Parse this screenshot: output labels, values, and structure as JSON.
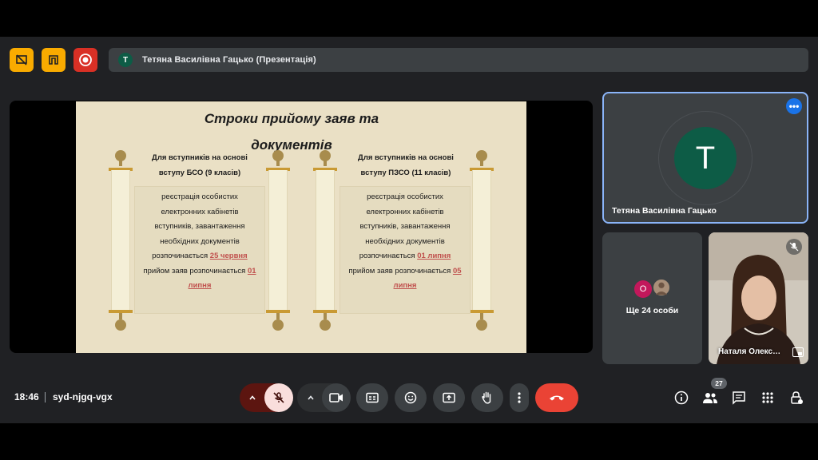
{
  "meeting": {
    "time": "18:46",
    "code": "syd-njgq-vgx",
    "presenter_bar_label": "Тетяна Василівна Гацько (Презентація)",
    "presenter_initial": "T"
  },
  "slide": {
    "title_line1": "Строки прийому заяв та",
    "title_line2": "документів",
    "left": {
      "heading_line1": "Для вступників на основі",
      "heading_line2": "вступу БСО (9 класів)",
      "lines": [
        "реєстрація особистих",
        "електронних кабінетів",
        "вступників, завантаження",
        "необхідних документів"
      ],
      "start_prefix": "розпочинається ",
      "start_date": "25 червня",
      "apps_prefix": "прийом заяв розпочинається ",
      "apps_date_a": "01",
      "apps_date_b": "липня"
    },
    "right": {
      "heading_line1": "Для вступників на основі",
      "heading_line2": "вступу ПЗСО (11 класів)",
      "lines": [
        "реєстрація особистих",
        "електронних кабінетів",
        "вступників, завантаження",
        "необхідних документів"
      ],
      "start_prefix": "розпочинається ",
      "start_date": "01 липня",
      "apps_prefix": "прийом заяв розпочинається ",
      "apps_date_a": "05",
      "apps_date_b": "липня"
    }
  },
  "tiles": {
    "main_name": "Тетяна Василівна Гацько",
    "main_initial": "T",
    "others_label": "Ще 24 особи",
    "others_initial": "O",
    "cam_name": "Натaля Олекс…"
  },
  "participants_count": "27",
  "colors": {
    "accent_blue": "#8ab4f8",
    "end_call": "#ea4335",
    "mic_muted": "#f9dedc",
    "avatar_green": "#0d5c46",
    "slide_bg": "#eae0c5",
    "highlight": "#c0504d"
  }
}
